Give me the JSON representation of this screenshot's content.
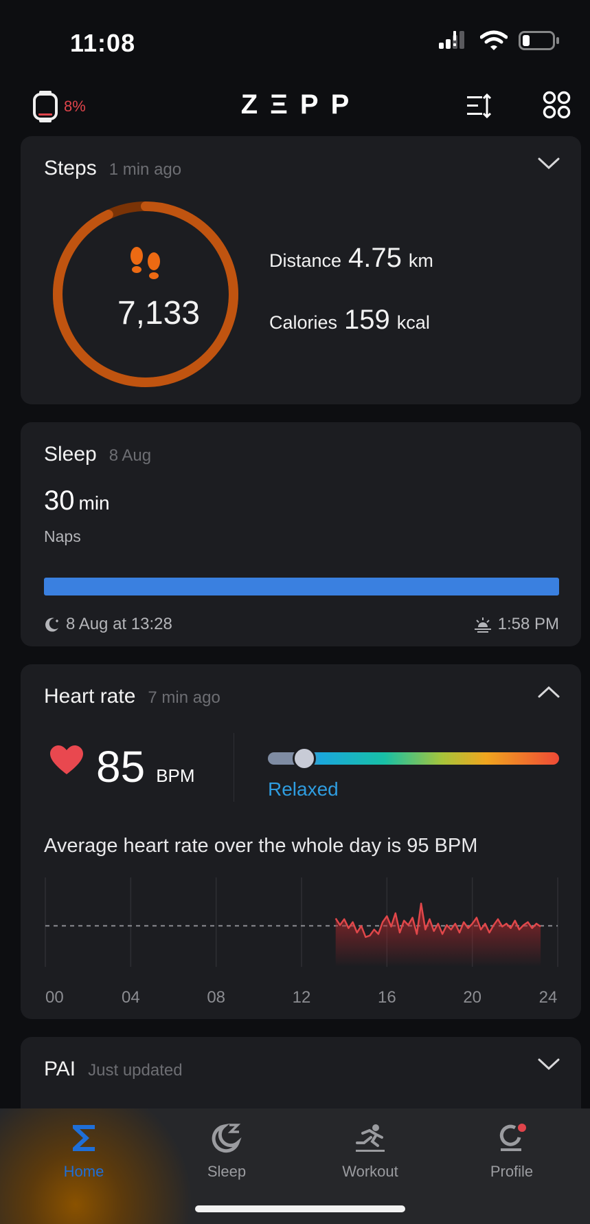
{
  "status_bar": {
    "time": "11:08"
  },
  "top_bar": {
    "battery": "8%",
    "logo": "ZΞPP"
  },
  "steps_card": {
    "title": "Steps",
    "updated": "1 min ago",
    "steps": "7,133",
    "goal_progress": 0.93,
    "distance_label": "Distance",
    "distance_value": "4.75",
    "distance_unit": "km",
    "calories_label": "Calories",
    "calories_value": "159",
    "calories_unit": "kcal"
  },
  "sleep_card": {
    "title": "Sleep",
    "date": "8 Aug",
    "value": "30",
    "unit": "min",
    "type": "Naps",
    "start": "8 Aug at 13:28",
    "end": "1:58 PM"
  },
  "heart_card": {
    "title": "Heart rate",
    "updated": "7 min ago",
    "value": "85",
    "unit": "BPM",
    "zone": "Relaxed",
    "average_text": "Average heart rate over the whole day is 95 BPM",
    "chart_data": {
      "type": "line",
      "x_ticks": [
        "00",
        "04",
        "08",
        "12",
        "16",
        "20",
        "24"
      ],
      "xlim": [
        0,
        24
      ],
      "ylim": [
        40,
        160
      ],
      "average": 95,
      "line_color": "#e0474a",
      "values": [
        [
          13.6,
          105
        ],
        [
          13.8,
          96
        ],
        [
          14.0,
          104
        ],
        [
          14.2,
          92
        ],
        [
          14.4,
          100
        ],
        [
          14.6,
          86
        ],
        [
          14.8,
          95
        ],
        [
          15.0,
          80
        ],
        [
          15.2,
          82
        ],
        [
          15.4,
          90
        ],
        [
          15.6,
          84
        ],
        [
          15.8,
          100
        ],
        [
          16.0,
          108
        ],
        [
          16.2,
          94
        ],
        [
          16.4,
          112
        ],
        [
          16.6,
          86
        ],
        [
          16.8,
          102
        ],
        [
          17.0,
          96
        ],
        [
          17.2,
          106
        ],
        [
          17.4,
          84
        ],
        [
          17.6,
          125
        ],
        [
          17.8,
          90
        ],
        [
          18.0,
          104
        ],
        [
          18.2,
          88
        ],
        [
          18.4,
          98
        ],
        [
          18.6,
          84
        ],
        [
          18.8,
          96
        ],
        [
          19.0,
          90
        ],
        [
          19.2,
          98
        ],
        [
          19.4,
          86
        ],
        [
          19.6,
          100
        ],
        [
          19.8,
          92
        ],
        [
          20.0,
          98
        ],
        [
          20.2,
          106
        ],
        [
          20.4,
          90
        ],
        [
          20.6,
          98
        ],
        [
          20.8,
          86
        ],
        [
          21.0,
          96
        ],
        [
          21.2,
          104
        ],
        [
          21.4,
          94
        ],
        [
          21.6,
          98
        ],
        [
          21.8,
          92
        ],
        [
          22.0,
          102
        ],
        [
          22.2,
          90
        ],
        [
          22.4,
          96
        ],
        [
          22.6,
          100
        ],
        [
          22.8,
          92
        ],
        [
          23.0,
          98
        ],
        [
          23.2,
          94
        ]
      ]
    }
  },
  "pai_card": {
    "title": "PAI",
    "updated": "Just updated"
  },
  "tab_bar": {
    "tabs": [
      {
        "label": "Home"
      },
      {
        "label": "Sleep"
      },
      {
        "label": "Workout"
      },
      {
        "label": "Profile"
      }
    ]
  },
  "colors": {
    "accent_orange": "#ec6a13",
    "ring_dark": "#7a3306",
    "battery_low": "#e0444b",
    "sleep_blue": "#3a80e0",
    "active_tab": "#1f6fd8",
    "heart_red": "#e9484f"
  }
}
